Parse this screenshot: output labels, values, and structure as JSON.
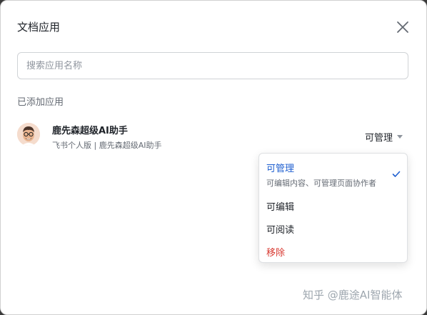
{
  "dialog": {
    "title": "文档应用",
    "search_placeholder": "搜索应用名称",
    "section_label": "已添加应用"
  },
  "app": {
    "name": "鹿先森超级AI助手",
    "subtitle": "飞书个人版 | 鹿先森超级AI助手",
    "permission": "可管理",
    "avatar_icon": "cartoon-avatar-icon"
  },
  "menu": {
    "items": [
      {
        "label": "可管理",
        "description": "可编辑内容、可管理页面协作者",
        "selected": true
      },
      {
        "label": "可编辑"
      },
      {
        "label": "可阅读"
      },
      {
        "label": "移除"
      }
    ],
    "check_icon": "check-icon"
  },
  "colors": {
    "accent": "#1f5fd0",
    "danger": "#d83931"
  },
  "watermark": "知乎 @鹿途AI智能体"
}
